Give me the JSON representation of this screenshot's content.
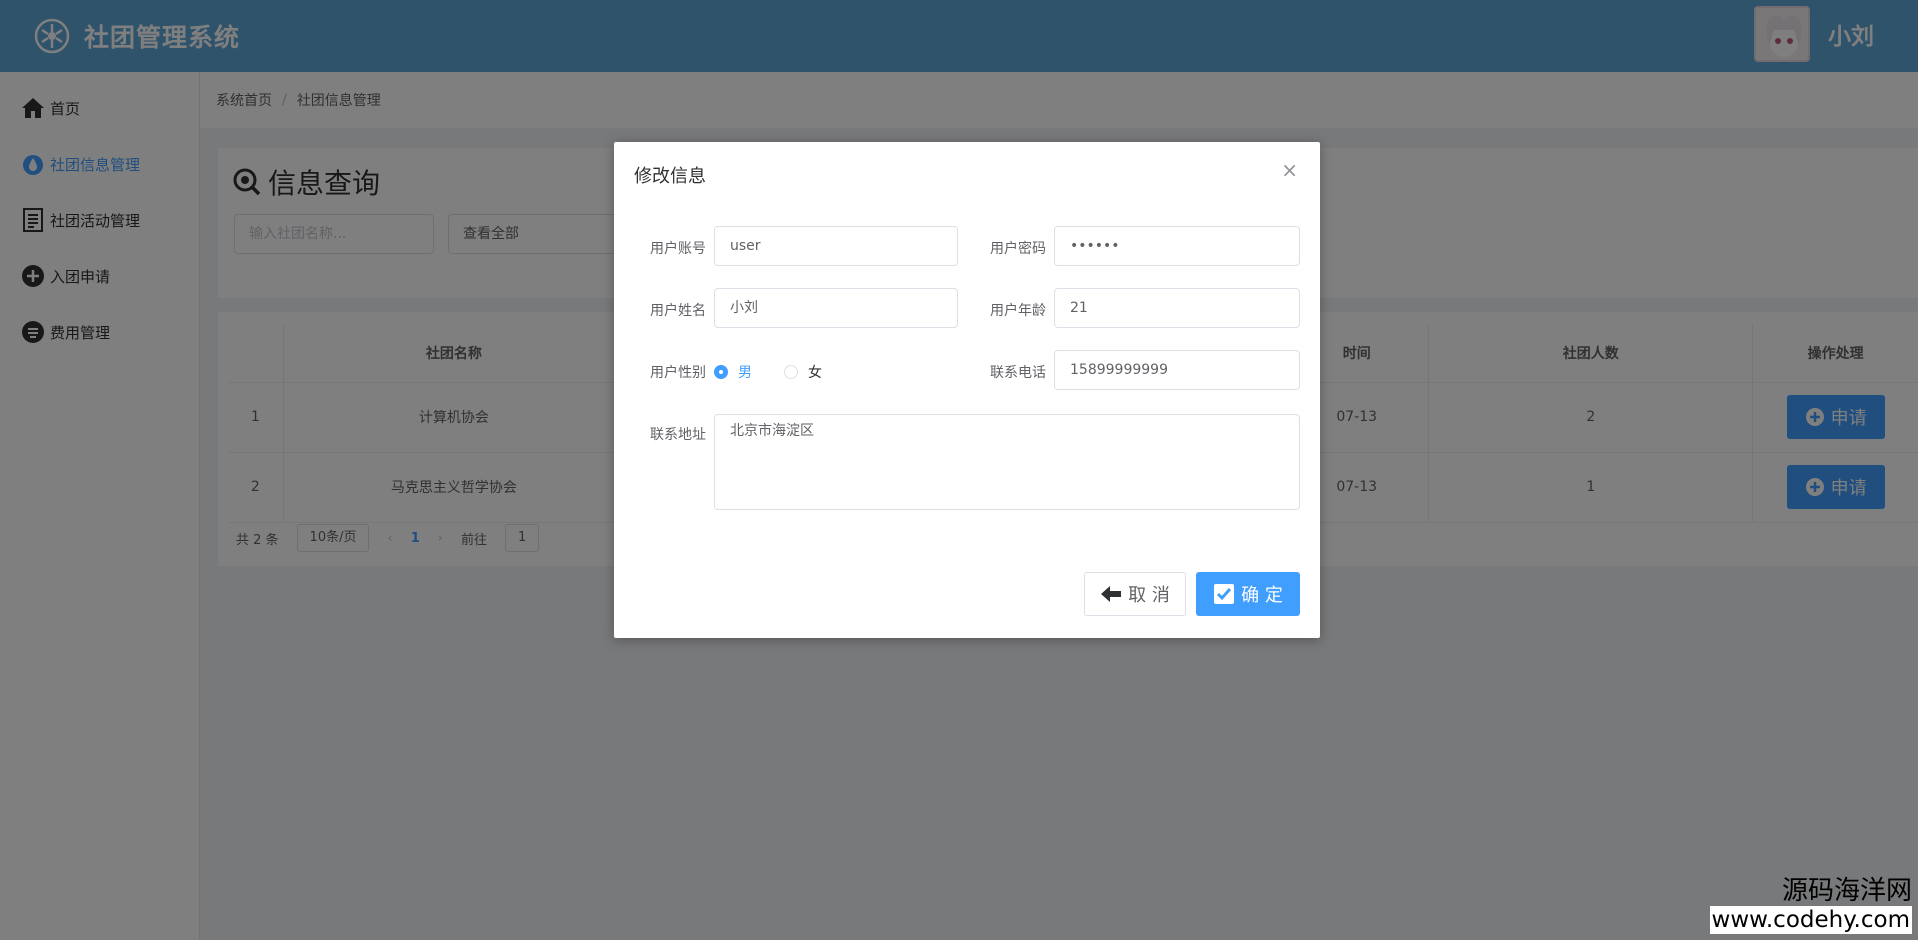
{
  "header": {
    "app_title": "社团管理系统",
    "username": "小刘",
    "logo_icon": "asterisk-circle-icon"
  },
  "sidebar": {
    "items": [
      {
        "label": "首页",
        "icon": "home-icon"
      },
      {
        "label": "社团信息管理",
        "icon": "drop-icon",
        "active": true
      },
      {
        "label": "社团活动管理",
        "icon": "document-icon"
      },
      {
        "label": "入团申请",
        "icon": "plus-circle-icon"
      },
      {
        "label": "费用管理",
        "icon": "coin-icon"
      }
    ]
  },
  "breadcrumb": {
    "home": "系统首页",
    "sep": "/",
    "current": "社团信息管理"
  },
  "query": {
    "title": "信息查询",
    "input_placeholder": "输入社团名称...",
    "select_value": "查看全部"
  },
  "table": {
    "headers": [
      "社团名称",
      "时间",
      "社团人数",
      "操作处理"
    ],
    "rows": [
      {
        "index": "1",
        "name": "计算机协会",
        "time": "07-13",
        "count": "2",
        "action": "申请"
      },
      {
        "index": "2",
        "name": "马克思主义哲学协会",
        "time": "07-13",
        "count": "1",
        "action": "申请"
      }
    ]
  },
  "pager": {
    "total": "共 2 条",
    "size": "10条/页",
    "prev": "‹",
    "page": "1",
    "next": "›",
    "goto": "前往",
    "goto_value": "1"
  },
  "dialog": {
    "title": "修改信息",
    "close": "×",
    "account_label": "用户账号",
    "account_value": "user",
    "password_label": "用户密码",
    "password_value": "••••••",
    "name_label": "用户姓名",
    "name_value": "小刘",
    "age_label": "用户年龄",
    "age_value": "21",
    "gender_label": "用户性别",
    "gender_male": "男",
    "gender_female": "女",
    "phone_label": "联系电话",
    "phone_value": "15899999999",
    "address_label": "联系地址",
    "address_value": "北京市海淀区",
    "cancel_label": "取 消",
    "ok_label": "确 定"
  },
  "watermark": {
    "line1": "源码海洋网",
    "line2": "www.codehy.com"
  },
  "colors": {
    "header": "#5ea7d6",
    "accent": "#409eff"
  }
}
